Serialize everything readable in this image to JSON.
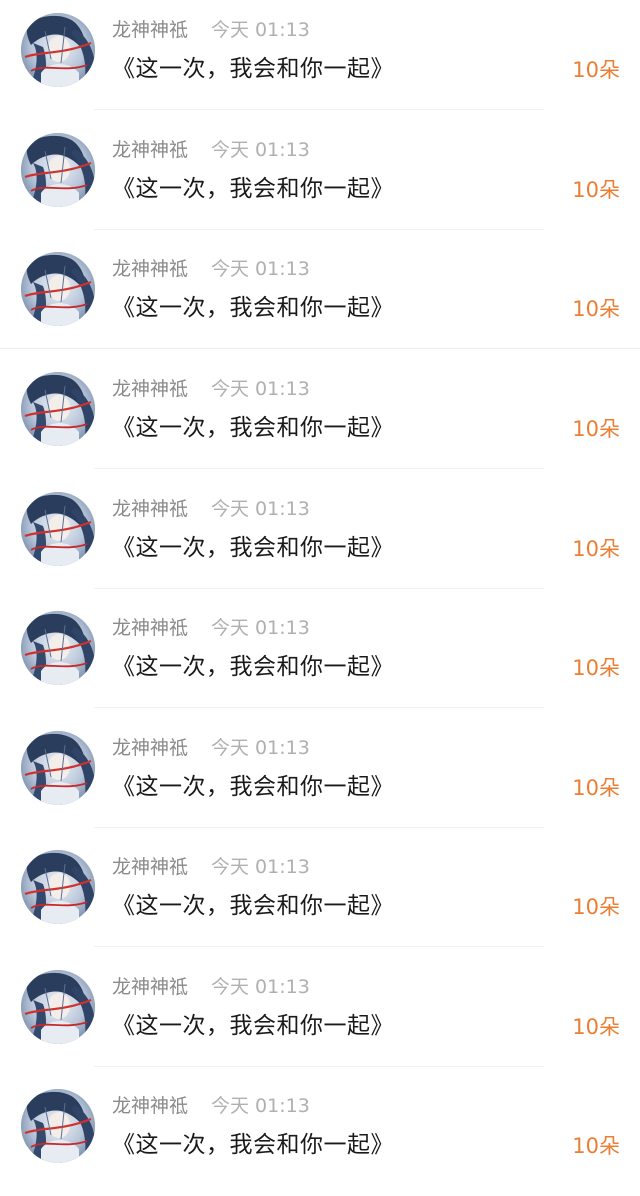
{
  "items": [
    {
      "name": "龙神神祗",
      "time": "今天 01:13",
      "message": "《这一次，我会和你一起》",
      "count": "10朵",
      "avatar_icon": "avatar-anime-character"
    },
    {
      "name": "龙神神祗",
      "time": "今天 01:13",
      "message": "《这一次，我会和你一起》",
      "count": "10朵",
      "avatar_icon": "avatar-anime-character"
    },
    {
      "name": "龙神神祗",
      "time": "今天 01:13",
      "message": "《这一次，我会和你一起》",
      "count": "10朵",
      "avatar_icon": "avatar-anime-character"
    },
    {
      "name": "龙神神祗",
      "time": "今天 01:13",
      "message": "《这一次，我会和你一起》",
      "count": "10朵",
      "avatar_icon": "avatar-anime-character"
    },
    {
      "name": "龙神神祗",
      "time": "今天 01:13",
      "message": "《这一次，我会和你一起》",
      "count": "10朵",
      "avatar_icon": "avatar-anime-character"
    },
    {
      "name": "龙神神祗",
      "time": "今天 01:13",
      "message": "《这一次，我会和你一起》",
      "count": "10朵",
      "avatar_icon": "avatar-anime-character"
    },
    {
      "name": "龙神神祗",
      "time": "今天 01:13",
      "message": "《这一次，我会和你一起》",
      "count": "10朵",
      "avatar_icon": "avatar-anime-character"
    },
    {
      "name": "龙神神祗",
      "time": "今天 01:13",
      "message": "《这一次，我会和你一起》",
      "count": "10朵",
      "avatar_icon": "avatar-anime-character"
    },
    {
      "name": "龙神神祗",
      "time": "今天 01:13",
      "message": "《这一次，我会和你一起》",
      "count": "10朵",
      "avatar_icon": "avatar-anime-character"
    },
    {
      "name": "龙神神祗",
      "time": "今天 01:13",
      "message": "《这一次，我会和你一起》",
      "count": "10朵",
      "avatar_icon": "avatar-anime-character"
    }
  ],
  "colors": {
    "name_text": "#8a8a8a",
    "time_text": "#b0b0b0",
    "message_text": "#1a1a1a",
    "count_accent": "#ec7e33",
    "divider": "#f0f0f0"
  }
}
